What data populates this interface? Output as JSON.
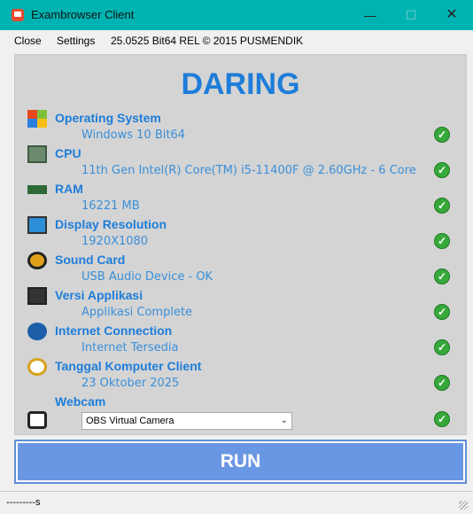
{
  "window": {
    "title": "Exambrowser Client"
  },
  "menu": {
    "close": "Close",
    "settings": "Settings",
    "version": "25.0525 Bit64 REL © 2015 PUSMENDIK"
  },
  "panel": {
    "heading": "DARING",
    "items": [
      {
        "label": "Operating System",
        "value": "Windows 10   Bit64",
        "icon": "windows-logo-icon"
      },
      {
        "label": "CPU",
        "value": "11th Gen Intel(R) Core(TM) i5-11400F @ 2.60GHz - 6 Core",
        "icon": "cpu-chip-icon"
      },
      {
        "label": "RAM",
        "value": "16221 MB",
        "icon": "ram-module-icon"
      },
      {
        "label": "Display Resolution",
        "value": "1920X1080",
        "icon": "monitor-icon"
      },
      {
        "label": "Sound Card",
        "value": "USB Audio Device - OK",
        "icon": "speaker-icon"
      },
      {
        "label": "Versi Applikasi",
        "value": "Applikasi Complete",
        "icon": "app-version-icon"
      },
      {
        "label": "Internet Connection",
        "value": "Internet Tersedia",
        "icon": "wifi-icon"
      },
      {
        "label": "Tanggal Komputer Client",
        "value": "23 Oktober 2025",
        "icon": "alarm-clock-icon"
      },
      {
        "label": "Webcam",
        "value": "",
        "icon": "webcam-icon"
      }
    ],
    "webcam_select": "OBS Virtual Camera",
    "check_symbol": "✓"
  },
  "run": {
    "label": "RUN"
  },
  "status": {
    "text": "---------s"
  },
  "colors": {
    "titlebar": "#00b3b3",
    "accent": "#1e7dd9",
    "run": "#6a97e3",
    "check": "#37a83a"
  }
}
